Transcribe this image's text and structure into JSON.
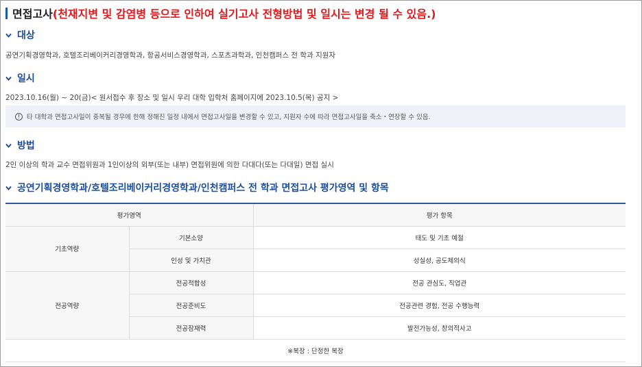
{
  "header": {
    "title": "면접고사",
    "notice": "(천재지변 및 감염병 등으로 인하여 실기고사 전형방법 및 일시는 변경 될 수 있음.)"
  },
  "target": {
    "heading": "대상",
    "text": "공연기획경영학과, 호텔조리베이커리경영학과, 항공서비스경영학과, 스포츠과학과, 인천캠퍼스 전 학과 지원자"
  },
  "schedule": {
    "heading": "일시",
    "text": "2023.10.16(월) ~ 20(금)< 원서접수 후 장소 및 일시 우리 대학 입학처 홈페이지에 2023.10.5(목) 공지 >",
    "notice": "타 대학과 면접고사일이 중복될 경우에 한해 정해진 일정 내에서 면접고사일을 변경할 수 있고, 지원자 수에 따라 면접고사일을 축소・연장할 수 있음."
  },
  "method": {
    "heading": "방법",
    "text": "2인 이상의 학과 교수 면접위원과 1인이상의 외부(또는 내부) 면접위원에 의한 다대다(또는 다대일) 면접 실시"
  },
  "evaluation": {
    "heading": "공연기획경영학과/호텔조리베이커리경영학과/인천캠퍼스 전 학과 면접고사 평가영역 및 항목",
    "col_area": "평가영역",
    "col_items": "평가 항목",
    "groups": [
      {
        "category": "기초역량",
        "rows": [
          {
            "sub": "기본소양",
            "items": "태도 및 기초 예절"
          },
          {
            "sub": "인성 및 가치관",
            "items": "성실성, 공도체의식"
          }
        ]
      },
      {
        "category": "전공역량",
        "rows": [
          {
            "sub": "전공적합성",
            "items": "전공 관심도, 직업관"
          },
          {
            "sub": "전공준비도",
            "items": "전공관련 경험, 전공 수행능력"
          },
          {
            "sub": "전공잠재력",
            "items": "발전가능성, 창의적사고"
          }
        ]
      }
    ],
    "footnote": "※복장 : 단정한 복장"
  },
  "colors": {
    "accent": "#1d4e9b",
    "warning": "#e0191c",
    "notice_bg": "#eef2f8"
  },
  "icons": {
    "section": "chevron-down-icon",
    "notice": "info-icon"
  }
}
